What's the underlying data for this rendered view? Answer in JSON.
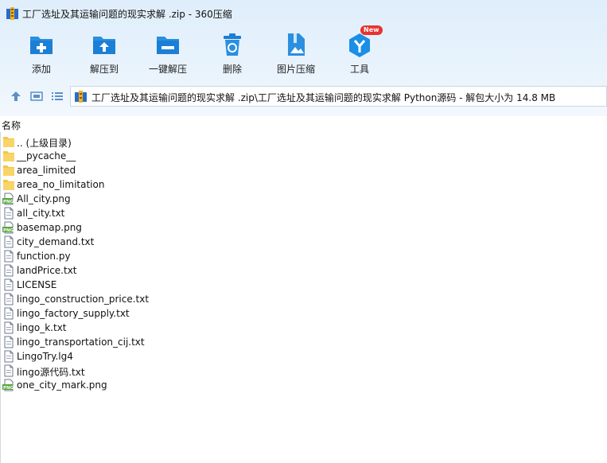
{
  "window": {
    "title": "工厂选址及其运输问题的现实求解 .zip - 360压缩"
  },
  "toolbar": {
    "add_label": "添加",
    "extract_label": "解压到",
    "one_click_label": "一键解压",
    "delete_label": "删除",
    "image_compress_label": "图片压缩",
    "tools_label": "工具",
    "new_badge": "New"
  },
  "path": {
    "text": "工厂选址及其运输问题的现实求解 .zip\\工厂选址及其运输问题的现实求解 Python源码 - 解包大小为 14.8 MB"
  },
  "list": {
    "column_name": "名称",
    "items": [
      {
        "name": ".. (上级目录)",
        "kind": "folder"
      },
      {
        "name": "__pycache__",
        "kind": "folder"
      },
      {
        "name": "area_limited",
        "kind": "folder"
      },
      {
        "name": "area_no_limitation",
        "kind": "folder"
      },
      {
        "name": "All_city.png",
        "kind": "png"
      },
      {
        "name": "all_city.txt",
        "kind": "file"
      },
      {
        "name": "basemap.png",
        "kind": "png"
      },
      {
        "name": "city_demand.txt",
        "kind": "file"
      },
      {
        "name": "function.py",
        "kind": "file"
      },
      {
        "name": "landPrice.txt",
        "kind": "file"
      },
      {
        "name": "LICENSE",
        "kind": "file"
      },
      {
        "name": "lingo_construction_price.txt",
        "kind": "file"
      },
      {
        "name": "lingo_factory_supply.txt",
        "kind": "file"
      },
      {
        "name": "lingo_k.txt",
        "kind": "file"
      },
      {
        "name": "lingo_transportation_cij.txt",
        "kind": "file"
      },
      {
        "name": "LingoTry.lg4",
        "kind": "file"
      },
      {
        "name": "lingo源代码.txt",
        "kind": "file"
      },
      {
        "name": "one_city_mark.png",
        "kind": "png"
      }
    ]
  }
}
